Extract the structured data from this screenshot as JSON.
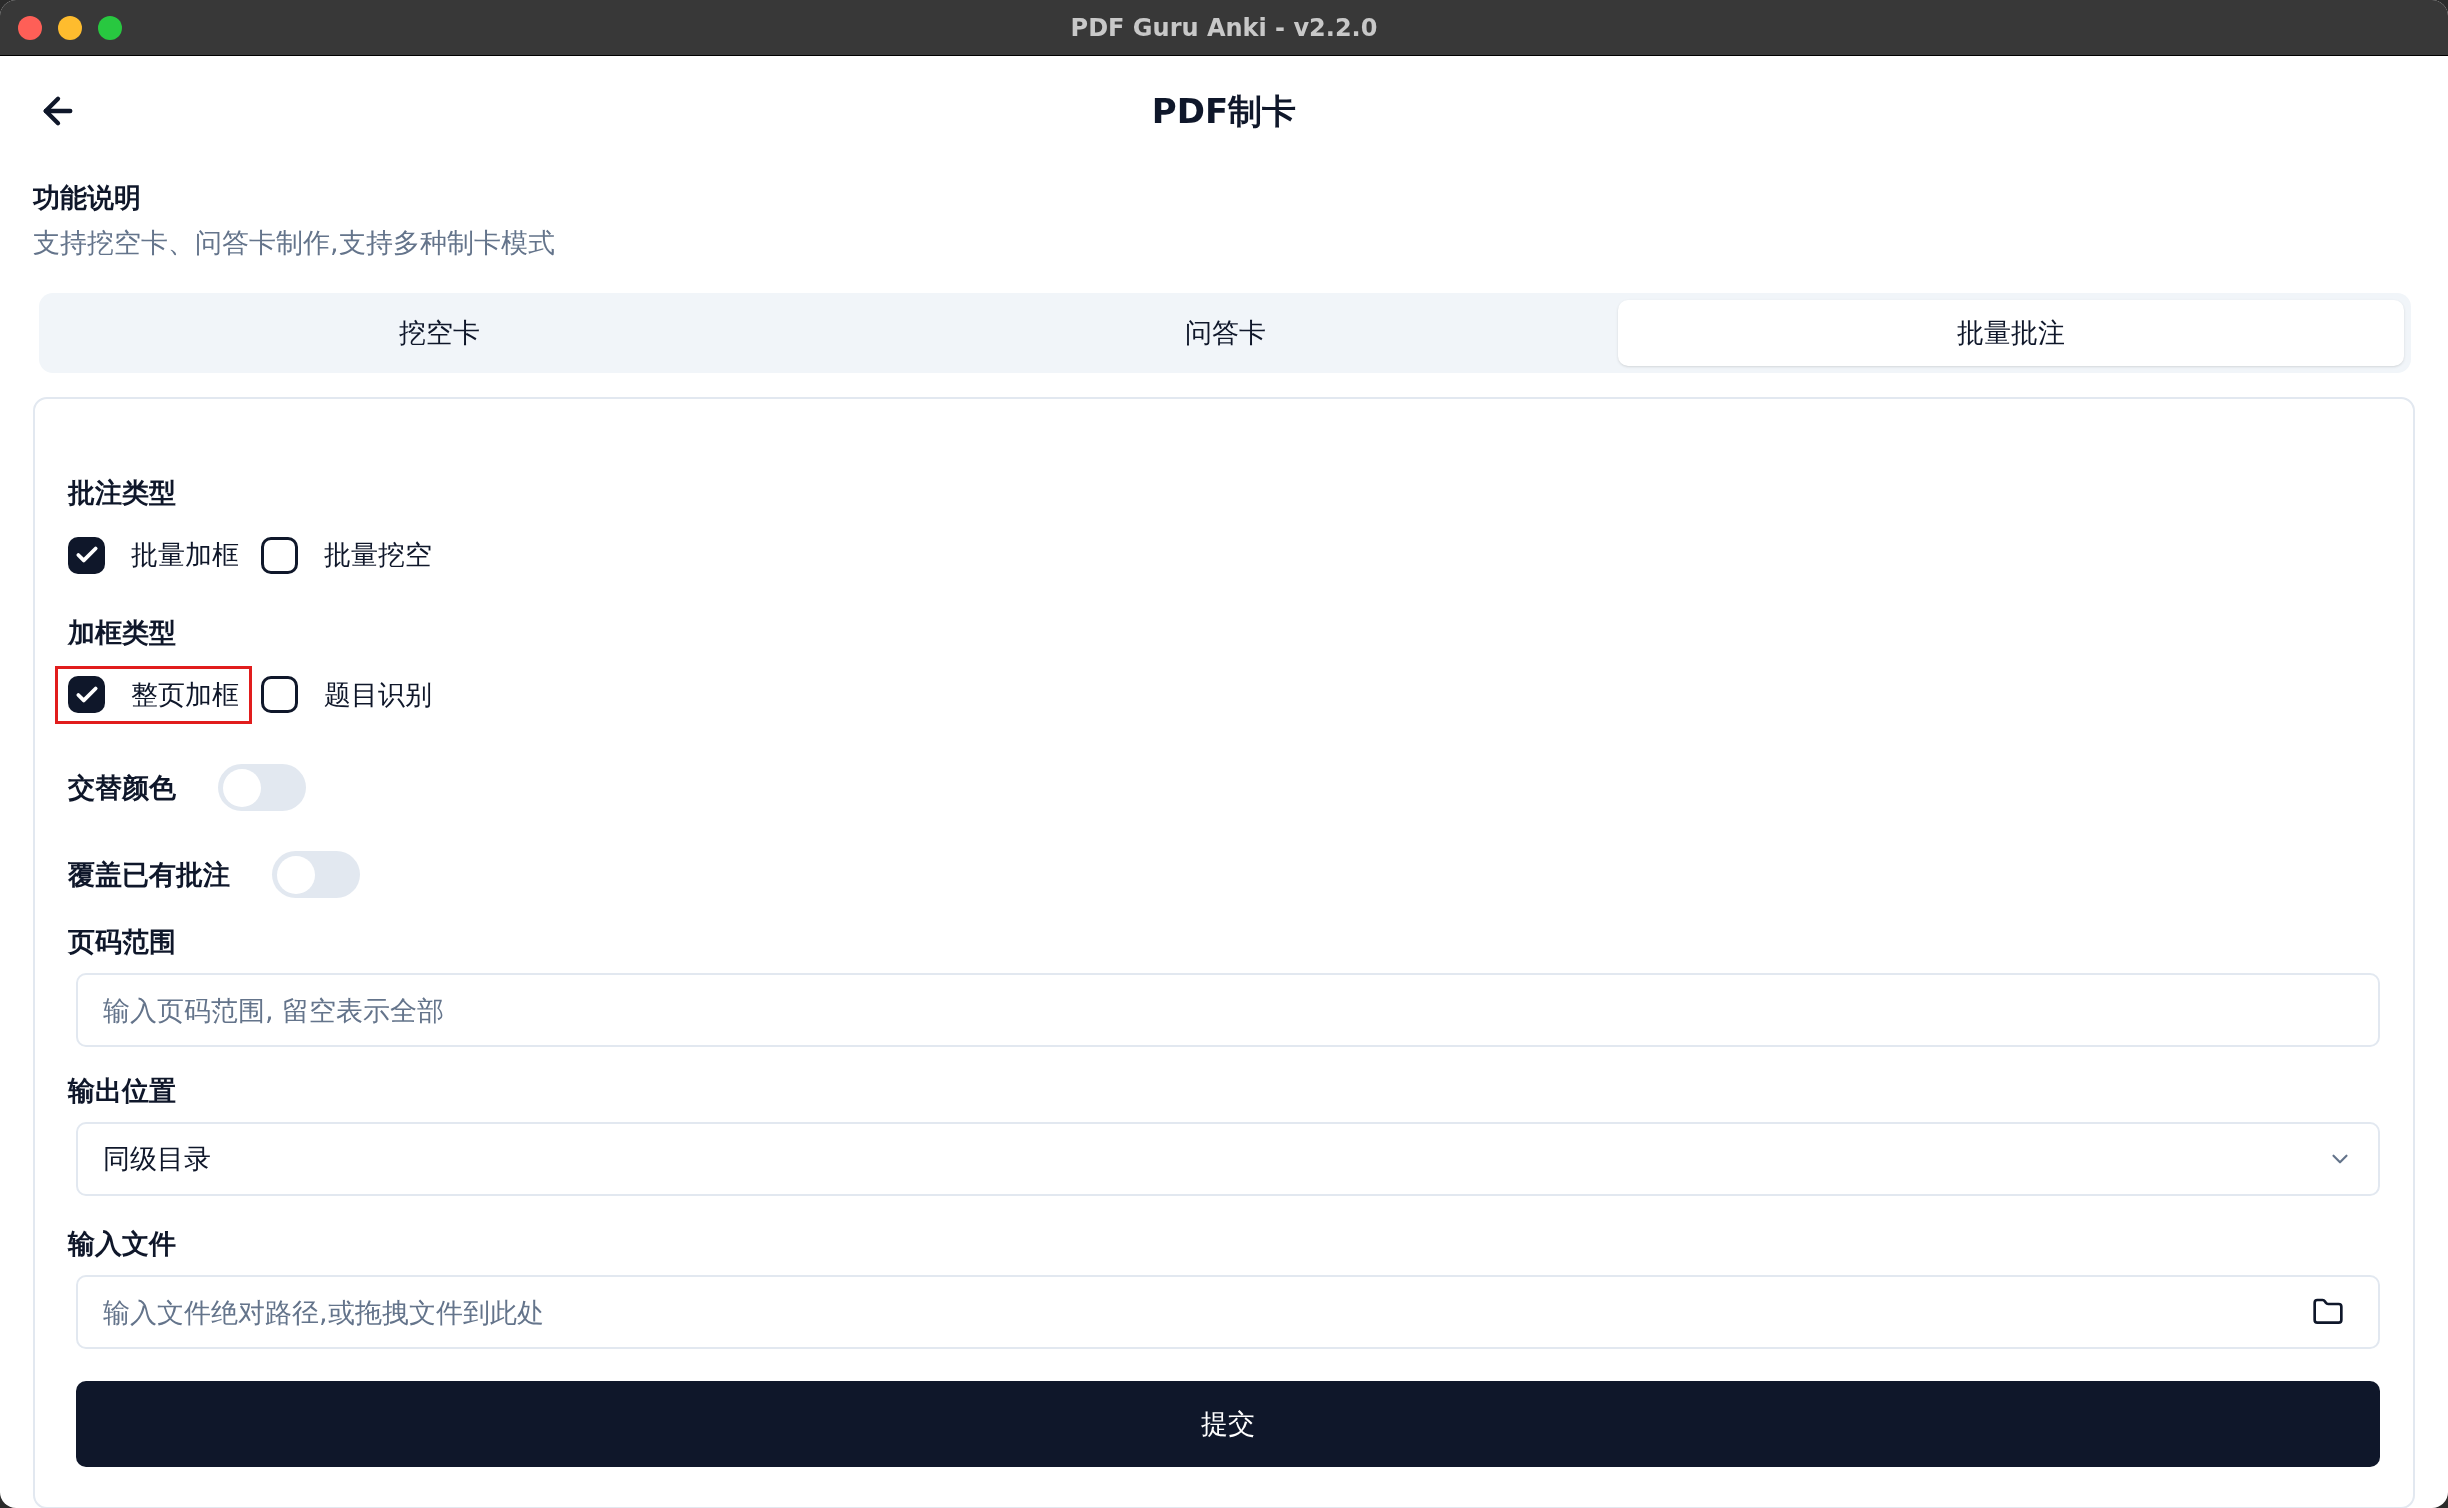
{
  "window": {
    "title": "PDF Guru Anki - v2.2.0"
  },
  "header": {
    "title": "PDF制卡"
  },
  "description": {
    "heading": "功能说明",
    "text": "支持挖空卡、问答卡制作,支持多种制卡模式"
  },
  "tabs": [
    {
      "label": "挖空卡",
      "selected": false
    },
    {
      "label": "问答卡",
      "selected": false
    },
    {
      "label": "批量批注",
      "selected": true
    }
  ],
  "form": {
    "fields": [
      {
        "kind": "checkboxes",
        "label": "批注类型",
        "options": [
          {
            "label": "批量加框",
            "checked": true,
            "highlighted": false
          },
          {
            "label": "批量挖空",
            "checked": false,
            "highlighted": false
          }
        ]
      },
      {
        "kind": "checkboxes",
        "label": "加框类型",
        "options": [
          {
            "label": "整页加框",
            "checked": true,
            "highlighted": true
          },
          {
            "label": "题目识别",
            "checked": false,
            "highlighted": false
          }
        ]
      },
      {
        "kind": "switch",
        "label": "交替颜色",
        "on": false
      },
      {
        "kind": "switch",
        "label": "覆盖已有批注",
        "on": false
      },
      {
        "kind": "text",
        "label": "页码范围",
        "placeholder": "输入页码范围, 留空表示全部"
      },
      {
        "kind": "select",
        "label": "输出位置",
        "value": "同级目录"
      },
      {
        "kind": "file",
        "label": "输入文件",
        "placeholder": "输入文件绝对路径,或拖拽文件到此处"
      }
    ],
    "submit": "提交"
  }
}
